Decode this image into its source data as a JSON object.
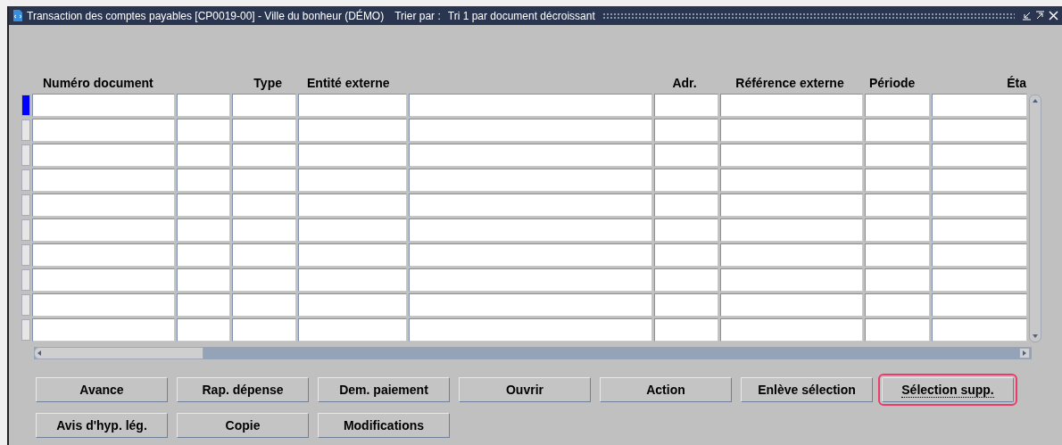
{
  "window": {
    "title": "Transaction des comptes payables [CP0019-00] - Ville du bonheur (DÉMO)",
    "sort_label": "Trier par :",
    "sort_value": "Tri 1 par document décroissant"
  },
  "table": {
    "columns": [
      "Numéro document",
      "Type",
      "Entité externe",
      "Adr.",
      "Référence externe",
      "Période",
      "Éta"
    ],
    "rows": [
      {
        "selected": true
      },
      {
        "selected": false
      },
      {
        "selected": false
      },
      {
        "selected": false
      },
      {
        "selected": false
      },
      {
        "selected": false
      },
      {
        "selected": false
      },
      {
        "selected": false
      },
      {
        "selected": false
      },
      {
        "selected": false
      }
    ]
  },
  "buttons": [
    {
      "label": "Avance",
      "focused": false
    },
    {
      "label": "Rap. dépense",
      "focused": false
    },
    {
      "label": "Dem. paiement",
      "focused": false
    },
    {
      "label": "Ouvrir",
      "focused": false
    },
    {
      "label": "Action",
      "focused": false
    },
    {
      "label": "Enlève sélection",
      "focused": false
    },
    {
      "label": "Sélection supp.",
      "focused": true
    },
    {
      "label": "Avis d'hyp. lég.",
      "focused": false
    },
    {
      "label": "Copie",
      "focused": false
    },
    {
      "label": "Modifications",
      "focused": false
    }
  ]
}
